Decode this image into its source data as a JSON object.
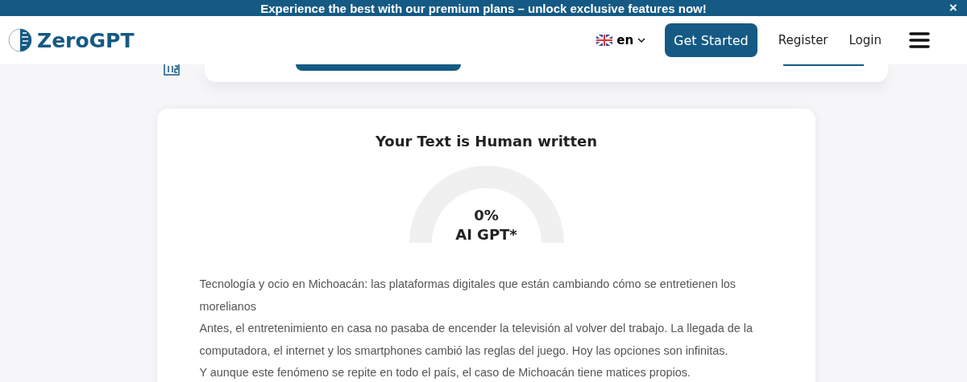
{
  "banner": {
    "text": "Experience the best with our premium plans – unlock exclusive features now!",
    "close": "×"
  },
  "header": {
    "logo": "ZeroGPT",
    "language": "en",
    "get_started": "Get Started",
    "links": [
      "Register",
      "Login"
    ]
  },
  "result": {
    "title": "Your Text is Human written",
    "gauge": {
      "percent": "0%",
      "label": "AI GPT*"
    },
    "paragraphs": [
      "Tecnología y ocio en Michoacán: las plataformas digitales que están cambiando cómo se entretienen los morelianos",
      "Antes, el entretenimiento en casa no pasaba de encender la televisión al volver del trabajo. La llegada de la computadora, el internet y los smartphones cambió las reglas del juego. Hoy las opciones son infinitas.",
      "Y aunque este fenómeno se repite en todo el país, el caso de Michoacán tiene matices propios."
    ]
  }
}
